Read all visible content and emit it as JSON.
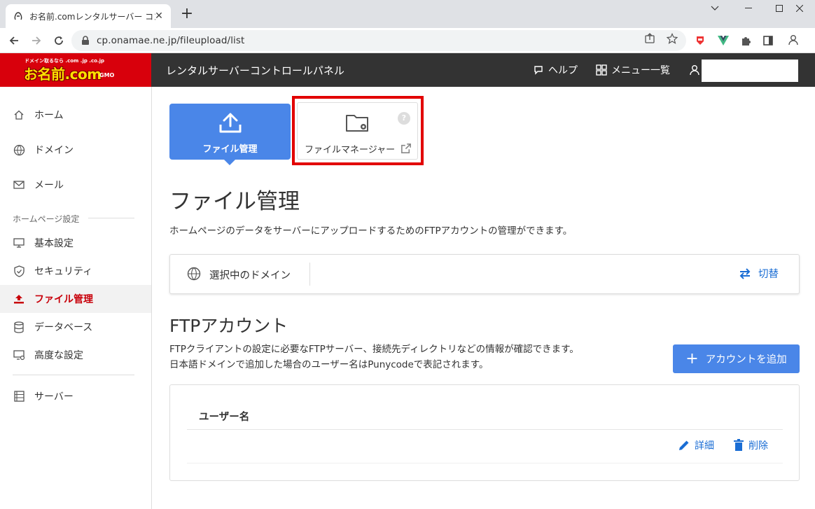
{
  "browser": {
    "tab_title": "お名前.comレンタルサーバー コントロー",
    "url": "cp.onamae.ne.jp/fileupload/list"
  },
  "header": {
    "logo_small": "ドメイン取るなら .com .jp .co.jp",
    "logo_big": "お名前.com",
    "logo_gmo": "GMO",
    "app_title": "レンタルサーバーコントロールパネル",
    "help": "ヘルプ",
    "menu": "メニュー一覧"
  },
  "sidebar": {
    "items": [
      {
        "label": "ホーム",
        "icon": "home-icon"
      },
      {
        "label": "ドメイン",
        "icon": "www-icon"
      },
      {
        "label": "メール",
        "icon": "mail-icon"
      }
    ],
    "group_label": "ホームページ設定",
    "group_items": [
      {
        "label": "基本設定",
        "icon": "monitor-icon"
      },
      {
        "label": "セキュリティ",
        "icon": "shield-icon"
      },
      {
        "label": "ファイル管理",
        "icon": "upload-icon",
        "active": true
      },
      {
        "label": "データベース",
        "icon": "database-icon"
      },
      {
        "label": "高度な設定",
        "icon": "advanced-icon"
      }
    ],
    "server": {
      "label": "サーバー",
      "icon": "server-icon"
    }
  },
  "tiles": {
    "file_manage": "ファイル管理",
    "file_manager": "ファイルマネージャー",
    "help_mark": "?"
  },
  "main": {
    "title": "ファイル管理",
    "description": "ホームページのデータをサーバーにアップロードするためのFTPアカウントの管理ができます。",
    "domain_label": "選択中のドメイン",
    "switch_label": "切替",
    "ftp_title": "FTPアカウント",
    "ftp_desc_1": "FTPクライアントの設定に必要なFTPサーバー、接続先ディレクトリなどの情報が確認できます。",
    "ftp_desc_2": "日本語ドメインで追加した場合のユーザー名はPunycodeで表記されます。",
    "add_account": "アカウントを追加",
    "table_header": "ユーザー名",
    "detail": "詳細",
    "delete": "削除"
  },
  "colors": {
    "brand_red": "#d8000c",
    "header_dark": "#333333",
    "accent_blue": "#4a86e8",
    "link_blue": "#1a6dd4",
    "highlight_red": "#e20000"
  }
}
